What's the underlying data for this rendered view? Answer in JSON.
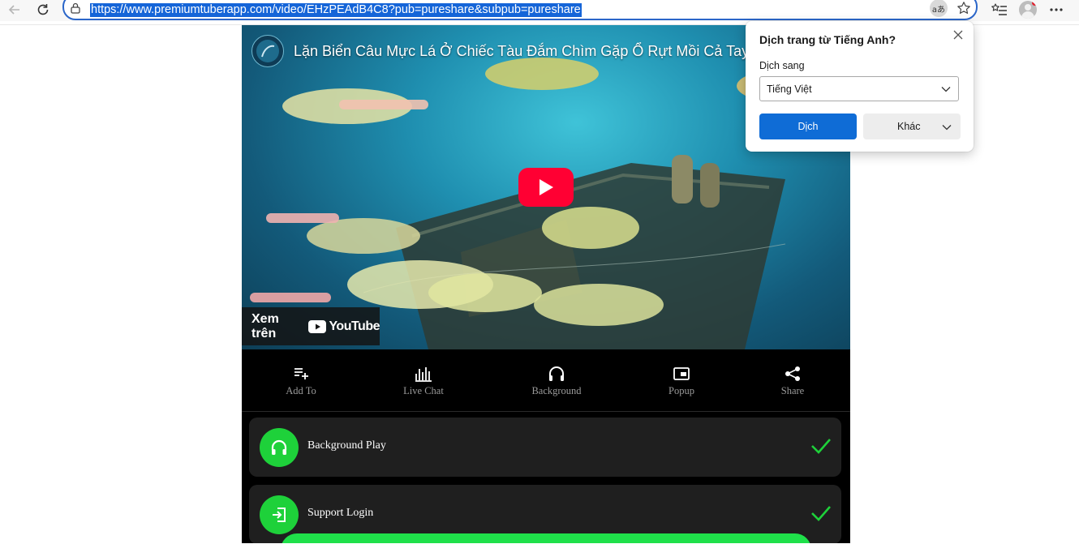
{
  "browser": {
    "url": "https://www.premiumtuberapp.com/video/EHzPEAdB4C8?pub=pureshare&subpub=pureshare",
    "translate_badge": "aあ",
    "icons": [
      "back-icon",
      "refresh-icon",
      "lock-icon",
      "translate-icon",
      "favorite-star-icon",
      "favorites-list-icon",
      "profile-avatar",
      "more-menu-icon"
    ]
  },
  "video": {
    "title": "Lặn Biển Câu Mực Lá Ở Chiếc Tàu Đắm Chìm Gặp Ổ Rựt Mồi Cả Tay | P",
    "watch_on_label": "Xem trên",
    "youtube_wordmark": "YouTube"
  },
  "actions": [
    {
      "label": "Add To",
      "icon": "playlist-add-icon"
    },
    {
      "label": "Live Chat",
      "icon": "bar-chart-icon"
    },
    {
      "label": "Background",
      "icon": "headphones-icon"
    },
    {
      "label": "Popup",
      "icon": "picture-in-picture-icon"
    },
    {
      "label": "Share",
      "icon": "share-icon"
    }
  ],
  "features": [
    {
      "label": "Background Play",
      "icon": "headphones-icon",
      "checked": true
    },
    {
      "label": "Support Login",
      "icon": "login-icon",
      "checked": true
    }
  ],
  "translate_popup": {
    "title": "Dịch trang từ Tiếng Anh?",
    "target_label": "Dịch sang",
    "target_language": "Tiếng Việt",
    "translate_button": "Dịch",
    "more_button": "Khác"
  },
  "colors": {
    "accent_green": "#1ed13a",
    "youtube_red": "#ff0033",
    "edge_blue": "#0f6cd6",
    "url_highlight": "#1565d8"
  }
}
